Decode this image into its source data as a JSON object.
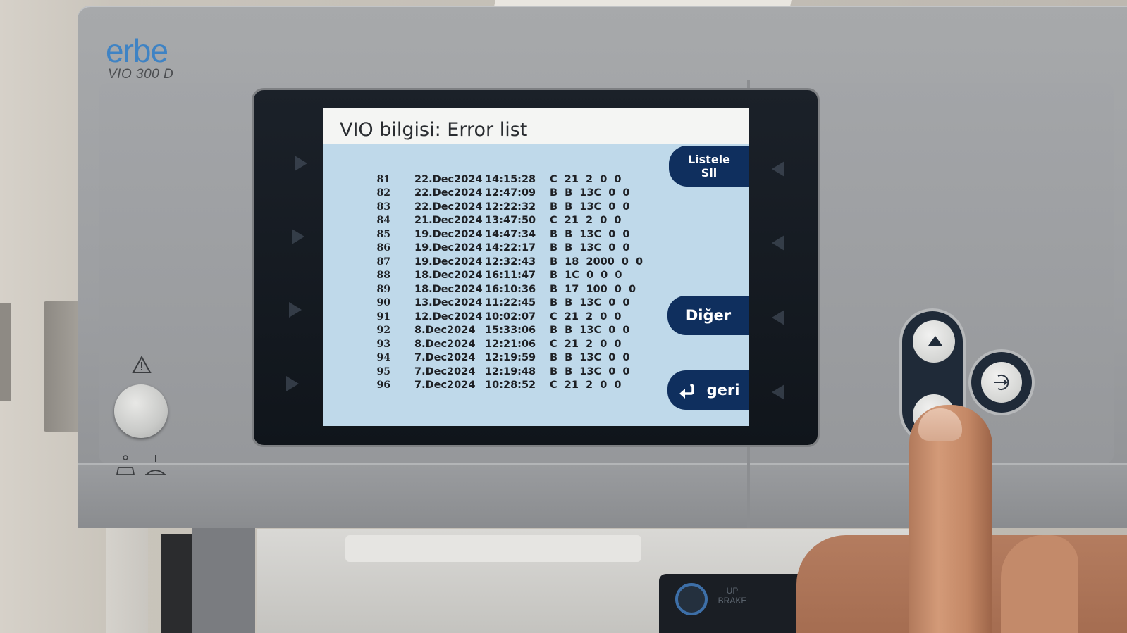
{
  "device": {
    "brand": "erbe",
    "model": "VIO 300 D"
  },
  "screen": {
    "title": "VIO bilgisi: Error list",
    "error_log": [
      {
        "num": "81",
        "date": "22.Dec2024",
        "time": "14:15:28",
        "code": "C  21  2  0  0"
      },
      {
        "num": "82",
        "date": "22.Dec2024",
        "time": "12:47:09",
        "code": "B  B  13C  0  0"
      },
      {
        "num": "83",
        "date": "22.Dec2024",
        "time": "12:22:32",
        "code": "B  B  13C  0  0"
      },
      {
        "num": "84",
        "date": "21.Dec2024",
        "time": "13:47:50",
        "code": "C  21  2  0  0"
      },
      {
        "num": "85",
        "date": "19.Dec2024",
        "time": "14:47:34",
        "code": "B  B  13C  0  0"
      },
      {
        "num": "86",
        "date": "19.Dec2024",
        "time": "14:22:17",
        "code": "B  B  13C  0  0"
      },
      {
        "num": "87",
        "date": "19.Dec2024",
        "time": "12:32:43",
        "code": "B  18  2000  0  0"
      },
      {
        "num": "88",
        "date": "18.Dec2024",
        "time": "16:11:47",
        "code": "B  1C  0  0  0"
      },
      {
        "num": "89",
        "date": "18.Dec2024",
        "time": "16:10:36",
        "code": "B  17  100  0  0"
      },
      {
        "num": "90",
        "date": "13.Dec2024",
        "time": "11:22:45",
        "code": "B  B  13C  0  0"
      },
      {
        "num": "91",
        "date": "12.Dec2024",
        "time": "10:02:07",
        "code": "C  21  2  0  0"
      },
      {
        "num": "92",
        "date": "8.Dec2024",
        "time": "15:33:06",
        "code": "B  B  13C  0  0"
      },
      {
        "num": "93",
        "date": "8.Dec2024",
        "time": "12:21:06",
        "code": "C  21  2  0  0"
      },
      {
        "num": "94",
        "date": "7.Dec2024",
        "time": "12:19:59",
        "code": "B  B  13C  0  0"
      },
      {
        "num": "95",
        "date": "7.Dec2024",
        "time": "12:19:48",
        "code": "B  B  13C  0  0"
      },
      {
        "num": "96",
        "date": "7.Dec2024",
        "time": "10:28:52",
        "code": "C  21  2  0  0"
      }
    ],
    "buttons": {
      "list_line1": "Listele",
      "list_line2": "Sil",
      "other": "Diğer",
      "back": "geri"
    }
  },
  "lower_panel": {
    "brake_line1": "UP",
    "brake_line2": "BRAKE"
  },
  "colors": {
    "screen_bg": "#bfd9ea",
    "softkey": "#0f2f5e",
    "brand_blue": "#3f83c4"
  },
  "icons": [
    "warning-icon",
    "standby-icon",
    "up-arrow-icon",
    "enter-icon",
    "back-arrow-icon",
    "side-arrow-icon"
  ]
}
